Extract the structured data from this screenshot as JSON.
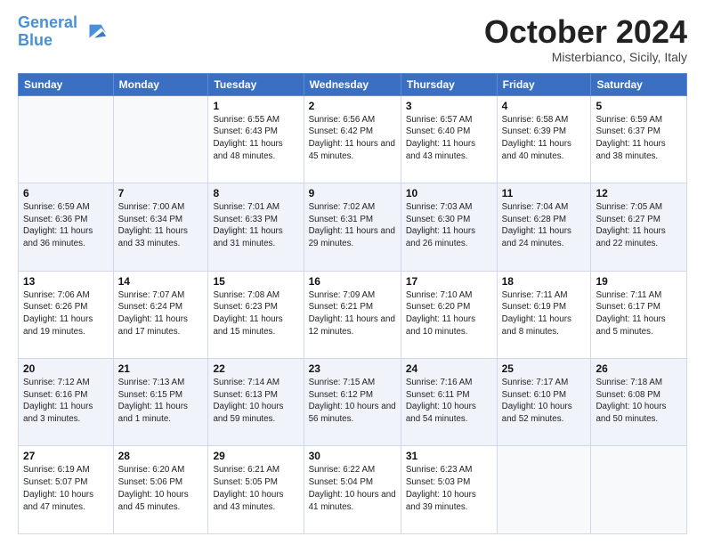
{
  "logo": {
    "line1": "General",
    "line2": "Blue"
  },
  "header": {
    "title": "October 2024",
    "subtitle": "Misterbianco, Sicily, Italy"
  },
  "days_of_week": [
    "Sunday",
    "Monday",
    "Tuesday",
    "Wednesday",
    "Thursday",
    "Friday",
    "Saturday"
  ],
  "weeks": [
    [
      {
        "day": "",
        "info": ""
      },
      {
        "day": "",
        "info": ""
      },
      {
        "day": "1",
        "info": "Sunrise: 6:55 AM\nSunset: 6:43 PM\nDaylight: 11 hours and 48 minutes."
      },
      {
        "day": "2",
        "info": "Sunrise: 6:56 AM\nSunset: 6:42 PM\nDaylight: 11 hours and 45 minutes."
      },
      {
        "day": "3",
        "info": "Sunrise: 6:57 AM\nSunset: 6:40 PM\nDaylight: 11 hours and 43 minutes."
      },
      {
        "day": "4",
        "info": "Sunrise: 6:58 AM\nSunset: 6:39 PM\nDaylight: 11 hours and 40 minutes."
      },
      {
        "day": "5",
        "info": "Sunrise: 6:59 AM\nSunset: 6:37 PM\nDaylight: 11 hours and 38 minutes."
      }
    ],
    [
      {
        "day": "6",
        "info": "Sunrise: 6:59 AM\nSunset: 6:36 PM\nDaylight: 11 hours and 36 minutes."
      },
      {
        "day": "7",
        "info": "Sunrise: 7:00 AM\nSunset: 6:34 PM\nDaylight: 11 hours and 33 minutes."
      },
      {
        "day": "8",
        "info": "Sunrise: 7:01 AM\nSunset: 6:33 PM\nDaylight: 11 hours and 31 minutes."
      },
      {
        "day": "9",
        "info": "Sunrise: 7:02 AM\nSunset: 6:31 PM\nDaylight: 11 hours and 29 minutes."
      },
      {
        "day": "10",
        "info": "Sunrise: 7:03 AM\nSunset: 6:30 PM\nDaylight: 11 hours and 26 minutes."
      },
      {
        "day": "11",
        "info": "Sunrise: 7:04 AM\nSunset: 6:28 PM\nDaylight: 11 hours and 24 minutes."
      },
      {
        "day": "12",
        "info": "Sunrise: 7:05 AM\nSunset: 6:27 PM\nDaylight: 11 hours and 22 minutes."
      }
    ],
    [
      {
        "day": "13",
        "info": "Sunrise: 7:06 AM\nSunset: 6:26 PM\nDaylight: 11 hours and 19 minutes."
      },
      {
        "day": "14",
        "info": "Sunrise: 7:07 AM\nSunset: 6:24 PM\nDaylight: 11 hours and 17 minutes."
      },
      {
        "day": "15",
        "info": "Sunrise: 7:08 AM\nSunset: 6:23 PM\nDaylight: 11 hours and 15 minutes."
      },
      {
        "day": "16",
        "info": "Sunrise: 7:09 AM\nSunset: 6:21 PM\nDaylight: 11 hours and 12 minutes."
      },
      {
        "day": "17",
        "info": "Sunrise: 7:10 AM\nSunset: 6:20 PM\nDaylight: 11 hours and 10 minutes."
      },
      {
        "day": "18",
        "info": "Sunrise: 7:11 AM\nSunset: 6:19 PM\nDaylight: 11 hours and 8 minutes."
      },
      {
        "day": "19",
        "info": "Sunrise: 7:11 AM\nSunset: 6:17 PM\nDaylight: 11 hours and 5 minutes."
      }
    ],
    [
      {
        "day": "20",
        "info": "Sunrise: 7:12 AM\nSunset: 6:16 PM\nDaylight: 11 hours and 3 minutes."
      },
      {
        "day": "21",
        "info": "Sunrise: 7:13 AM\nSunset: 6:15 PM\nDaylight: 11 hours and 1 minute."
      },
      {
        "day": "22",
        "info": "Sunrise: 7:14 AM\nSunset: 6:13 PM\nDaylight: 10 hours and 59 minutes."
      },
      {
        "day": "23",
        "info": "Sunrise: 7:15 AM\nSunset: 6:12 PM\nDaylight: 10 hours and 56 minutes."
      },
      {
        "day": "24",
        "info": "Sunrise: 7:16 AM\nSunset: 6:11 PM\nDaylight: 10 hours and 54 minutes."
      },
      {
        "day": "25",
        "info": "Sunrise: 7:17 AM\nSunset: 6:10 PM\nDaylight: 10 hours and 52 minutes."
      },
      {
        "day": "26",
        "info": "Sunrise: 7:18 AM\nSunset: 6:08 PM\nDaylight: 10 hours and 50 minutes."
      }
    ],
    [
      {
        "day": "27",
        "info": "Sunrise: 6:19 AM\nSunset: 5:07 PM\nDaylight: 10 hours and 47 minutes."
      },
      {
        "day": "28",
        "info": "Sunrise: 6:20 AM\nSunset: 5:06 PM\nDaylight: 10 hours and 45 minutes."
      },
      {
        "day": "29",
        "info": "Sunrise: 6:21 AM\nSunset: 5:05 PM\nDaylight: 10 hours and 43 minutes."
      },
      {
        "day": "30",
        "info": "Sunrise: 6:22 AM\nSunset: 5:04 PM\nDaylight: 10 hours and 41 minutes."
      },
      {
        "day": "31",
        "info": "Sunrise: 6:23 AM\nSunset: 5:03 PM\nDaylight: 10 hours and 39 minutes."
      },
      {
        "day": "",
        "info": ""
      },
      {
        "day": "",
        "info": ""
      }
    ]
  ]
}
